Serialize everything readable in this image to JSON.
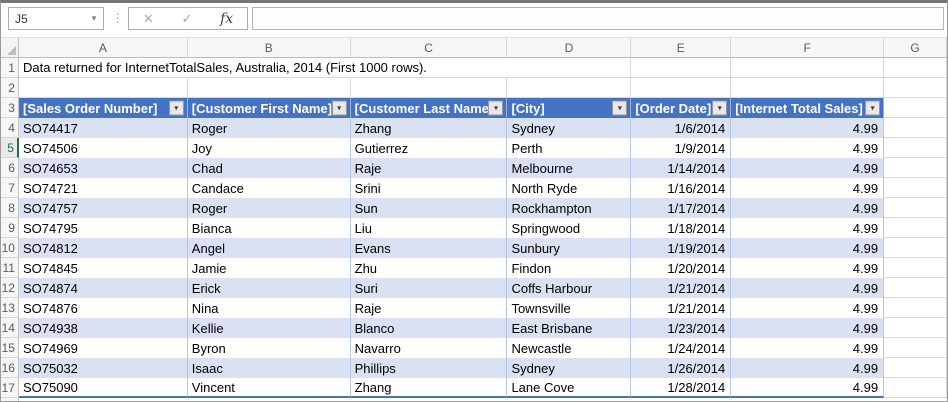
{
  "formula_bar": {
    "name_box_value": "J5",
    "formula_value": "",
    "icons": {
      "name_dropdown": "▾",
      "separator_dots": "⋮",
      "cancel": "✕",
      "enter": "✓",
      "insert_function": "fx"
    }
  },
  "grid": {
    "column_letters": [
      "A",
      "B",
      "C",
      "D",
      "E",
      "F",
      "G"
    ],
    "row_numbers": [
      1,
      2,
      3,
      4,
      5,
      6,
      7,
      8,
      9,
      10,
      11,
      12,
      13,
      14,
      15,
      16,
      17
    ],
    "note_row1": "Data returned for InternetTotalSales, Australia, 2014 (First 1000 rows)."
  },
  "table": {
    "filter_icon": "▾",
    "headers": [
      "[Sales Order Number]",
      "[Customer First Name]",
      "[Customer Last Name]",
      "[City]",
      "[Order Date]",
      "[Internet Total Sales]"
    ],
    "rows": [
      [
        "SO74417",
        "Roger",
        "Zhang",
        "Sydney",
        "1/6/2014",
        "4.99"
      ],
      [
        "SO74506",
        "Joy",
        "Gutierrez",
        "Perth",
        "1/9/2014",
        "4.99"
      ],
      [
        "SO74653",
        "Chad",
        "Raje",
        "Melbourne",
        "1/14/2014",
        "4.99"
      ],
      [
        "SO74721",
        "Candace",
        "Srini",
        "North Ryde",
        "1/16/2014",
        "4.99"
      ],
      [
        "SO74757",
        "Roger",
        "Sun",
        "Rockhampton",
        "1/17/2014",
        "4.99"
      ],
      [
        "SO74795",
        "Bianca",
        "Liu",
        "Springwood",
        "1/18/2014",
        "4.99"
      ],
      [
        "SO74812",
        "Angel",
        "Evans",
        "Sunbury",
        "1/19/2014",
        "4.99"
      ],
      [
        "SO74845",
        "Jamie",
        "Zhu",
        "Findon",
        "1/20/2014",
        "4.99"
      ],
      [
        "SO74874",
        "Erick",
        "Suri",
        "Coffs Harbour",
        "1/21/2014",
        "4.99"
      ],
      [
        "SO74876",
        "Nina",
        "Raje",
        "Townsville",
        "1/21/2014",
        "4.99"
      ],
      [
        "SO74938",
        "Kellie",
        "Blanco",
        "East Brisbane",
        "1/23/2014",
        "4.99"
      ],
      [
        "SO74969",
        "Byron",
        "Navarro",
        "Newcastle",
        "1/24/2014",
        "4.99"
      ],
      [
        "SO75032",
        "Isaac",
        "Phillips",
        "Sydney",
        "1/26/2014",
        "4.99"
      ],
      [
        "SO75090",
        "Vincent",
        "Zhang",
        "Lane Cove",
        "1/28/2014",
        "4.99"
      ]
    ]
  },
  "selection": {
    "active_cell": "J5",
    "highlighted_row": 5
  },
  "colors": {
    "table_header_fill": "#4472C4",
    "table_header_text": "#FFFFFF",
    "band_fill": "#D9E1F2",
    "table_grid": "#B4C6E7",
    "table_bottom_border": "#4472C4",
    "active_row_accent": "#217346",
    "gridline": "#D9D9D9"
  }
}
